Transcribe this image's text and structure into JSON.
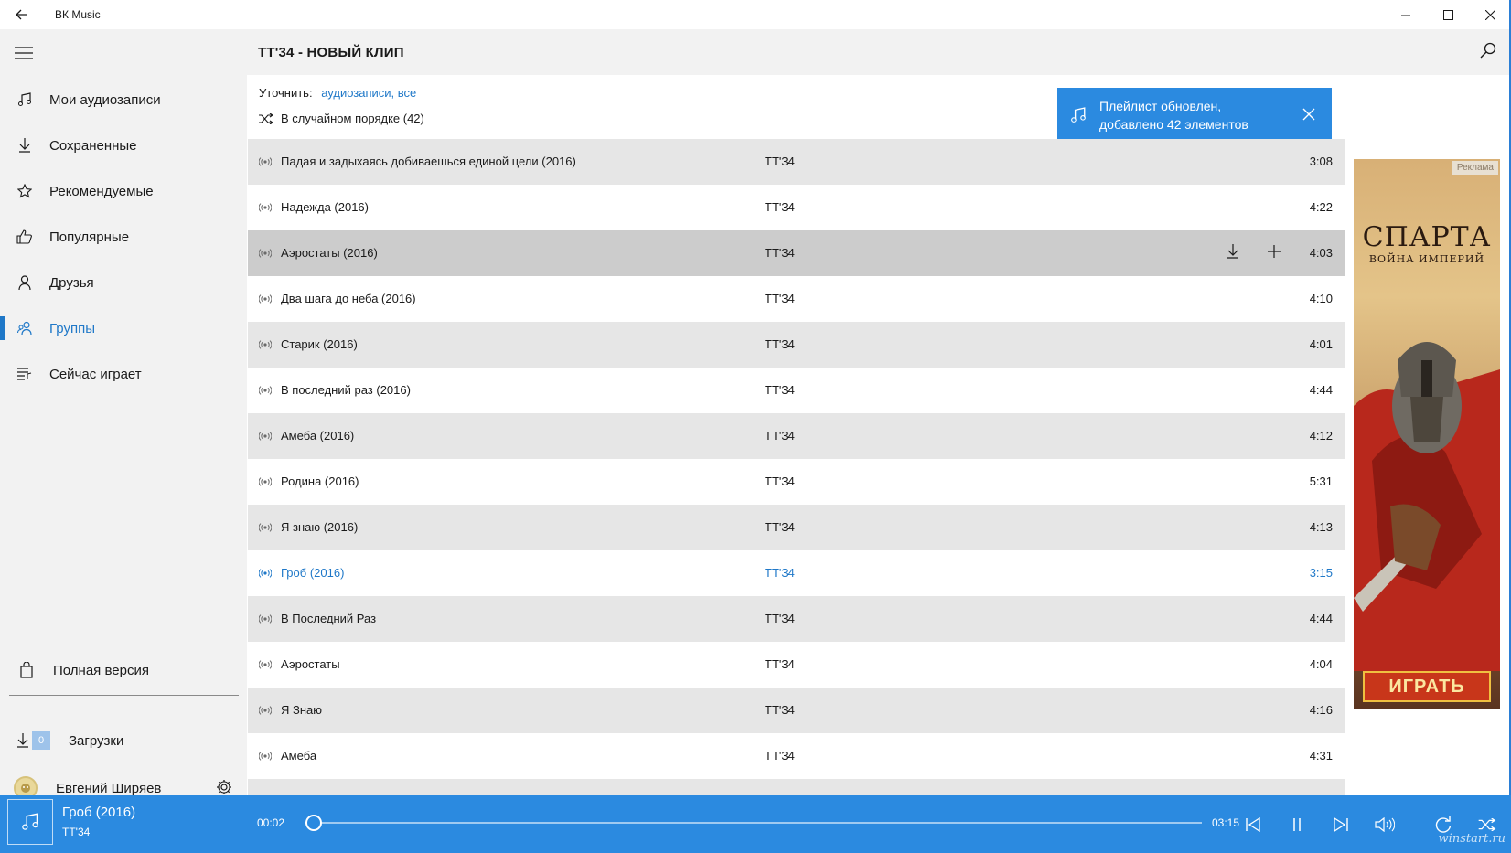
{
  "window": {
    "title": "ВК Music",
    "back_icon": "arrow-left-icon",
    "controls": [
      "minimize-icon",
      "maximize-icon",
      "close-icon"
    ]
  },
  "sidebar": {
    "menu_icon": "hamburger-icon",
    "items": [
      {
        "label": "Мои аудиозаписи",
        "icon": "music-note-icon",
        "active": false
      },
      {
        "label": "Сохраненные",
        "icon": "download-icon",
        "active": false
      },
      {
        "label": "Рекомендуемые",
        "icon": "star-icon",
        "active": false
      },
      {
        "label": "Популярные",
        "icon": "thumbs-up-icon",
        "active": false
      },
      {
        "label": "Друзья",
        "icon": "person-icon",
        "active": false
      },
      {
        "label": "Группы",
        "icon": "group-icon",
        "active": true
      },
      {
        "label": "Сейчас играет",
        "icon": "playlist-icon",
        "active": false
      }
    ],
    "full_version": {
      "label": "Полная версия",
      "icon": "shopping-bag-icon"
    },
    "downloads": {
      "label": "Загрузки",
      "count": "0",
      "icon": "download-icon"
    },
    "user": {
      "name": "Евгений Ширяев",
      "settings_icon": "gear-icon"
    }
  },
  "header": {
    "title": "ТТ'34 - НОВЫЙ КЛИП",
    "search_icon": "search-icon"
  },
  "filter": {
    "label": "Уточнить:",
    "value": "аудиозаписи, все"
  },
  "shuffle": {
    "label": "В случайном порядке (42)",
    "icon": "shuffle-icon"
  },
  "toast": {
    "message": "Плейлист обновлен, добавлено 42 элементов",
    "icon": "music-note-icon",
    "close_icon": "close-icon"
  },
  "tracks": [
    {
      "title": "Падая и задыхаясь добиваешься единой цели (2016)",
      "artist": "ТТ'34",
      "duration": "3:08"
    },
    {
      "title": "Надежда (2016)",
      "artist": "ТТ'34",
      "duration": "4:22"
    },
    {
      "title": "Аэростаты (2016)",
      "artist": "ТТ'34",
      "duration": "4:03",
      "hover": true
    },
    {
      "title": "Два шага до неба (2016)",
      "artist": "ТТ'34",
      "duration": "4:10"
    },
    {
      "title": "Старик (2016)",
      "artist": "ТТ'34",
      "duration": "4:01"
    },
    {
      "title": "В последний раз (2016)",
      "artist": "ТТ'34",
      "duration": "4:44"
    },
    {
      "title": "Амеба (2016)",
      "artist": "ТТ'34",
      "duration": "4:12"
    },
    {
      "title": "Родина (2016)",
      "artist": "ТТ'34",
      "duration": "5:31"
    },
    {
      "title": "Я знаю (2016)",
      "artist": "ТТ'34",
      "duration": "4:13"
    },
    {
      "title": "Гроб (2016)",
      "artist": "ТТ'34",
      "duration": "3:15",
      "playing": true
    },
    {
      "title": "В Последний Раз",
      "artist": "ТТ'34",
      "duration": "4:44"
    },
    {
      "title": "Аэростаты",
      "artist": "ТТ'34",
      "duration": "4:04"
    },
    {
      "title": "Я Знаю",
      "artist": "ТТ'34",
      "duration": "4:16"
    },
    {
      "title": "Амеба",
      "artist": "ТТ'34",
      "duration": "4:31"
    },
    {
      "title": "",
      "artist": "",
      "duration": ""
    }
  ],
  "ad": {
    "tag": "Реклама",
    "title": "СПАРТА",
    "subtitle": "ВОЙНА ИМПЕРИЙ",
    "cta": "ИГРАТЬ"
  },
  "player": {
    "title": "Гроб (2016)",
    "artist": "ТТ'34",
    "current_time": "00:02",
    "total_time": "03:15",
    "progress": 0.01,
    "controls": [
      "previous-icon",
      "pause-icon",
      "next-icon",
      "volume-icon",
      "repeat-icon",
      "shuffle-icon"
    ]
  },
  "watermark": "winstart.ru",
  "colors": {
    "accent": "#2b8ae0",
    "active_text": "#1f78c8",
    "sidebar_bg": "#f2f2f2",
    "row_alt": "#e6e6e6",
    "row_hover": "#cccccc"
  }
}
